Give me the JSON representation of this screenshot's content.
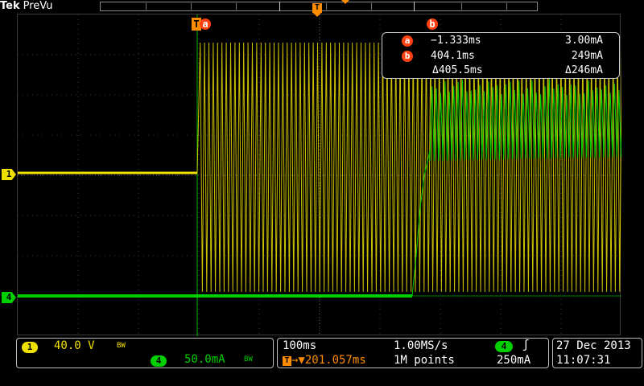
{
  "header": {
    "brand": "Tek",
    "mode": "PreVu"
  },
  "cursors": {
    "label_a": "a",
    "label_b": "b",
    "trigger_glyph": "T",
    "readout": {
      "a": {
        "time": "−1.333ms",
        "value": "3.00mA"
      },
      "b": {
        "time": "404.1ms",
        "value": "249mA"
      },
      "delta": {
        "time": "Δ405.5ms",
        "value": "Δ246mA"
      }
    }
  },
  "channels": {
    "ch1": {
      "number": "1",
      "scale": "40.0 V",
      "bw_glyph": "BW",
      "color": "#f0e000"
    },
    "ch4": {
      "number": "4",
      "scale": "50.0mA",
      "bw_glyph": "BW",
      "color": "#00d000"
    }
  },
  "horizontal": {
    "timebase": "100ms",
    "sample_rate": "1.00MS/s",
    "trigger_position": "201.057ms",
    "trigger_position_icon": "T→▼",
    "record_length": "1M points"
  },
  "trigger": {
    "source": "4",
    "slope_glyph": "∫",
    "level": "250mA"
  },
  "datetime": {
    "date": "27 Dec 2013",
    "time": "11:07:31"
  },
  "colors": {
    "ch1": "#f0e000",
    "ch4": "#00d000",
    "trigger": "#ff8c00",
    "cursor": "#ff4010"
  }
}
